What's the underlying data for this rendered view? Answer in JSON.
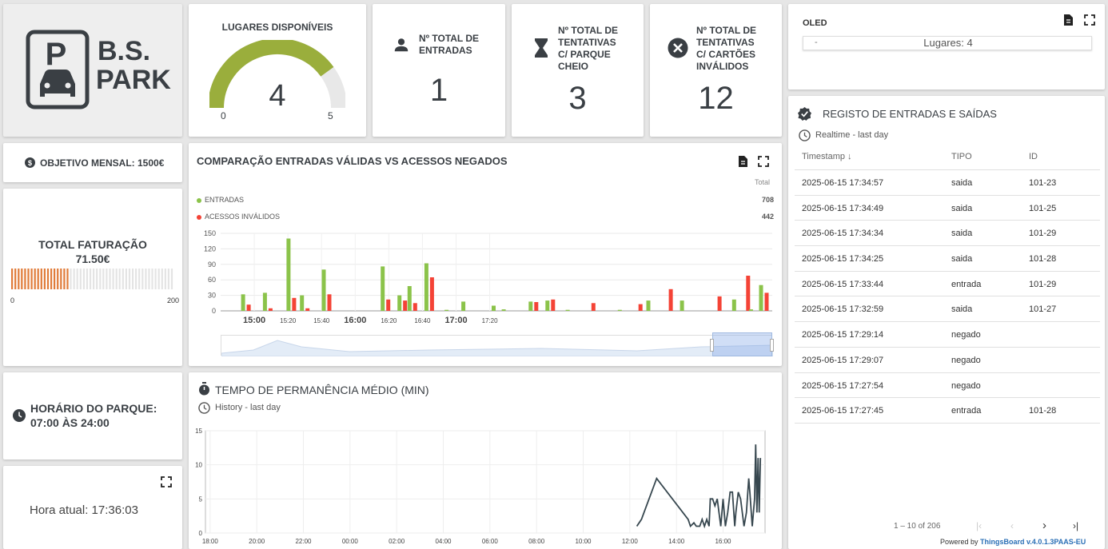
{
  "logo": {
    "title_line1": "B.S.",
    "title_line2": "PARK",
    "sign_letter": "P"
  },
  "lugares": {
    "title": "LUGARES DISPONÍVEIS",
    "value": "4",
    "min": "0",
    "max": "5",
    "fraction": 0.8
  },
  "entradas": {
    "title": "Nº TOTAL DE ENTRADAS",
    "value": "1"
  },
  "tentativas_cheio": {
    "title_lines": [
      "Nº TOTAL DE",
      "TENTATIVAS",
      "C/ PARQUE",
      "CHEIO"
    ],
    "value": "3"
  },
  "tentativas_invalidos": {
    "title_lines": [
      "Nº TOTAL DE",
      "TENTATIVAS",
      "C/ CARTÕES",
      "INVÁLIDOS"
    ],
    "value": "12"
  },
  "oled": {
    "title": "OLED",
    "dash": "-",
    "text": "Lugares: 4"
  },
  "objetivo": {
    "label": "OBJETIVO MENSAL: 1500€"
  },
  "faturacao": {
    "title": "TOTAL FATURAÇÃO",
    "value": "71.50€",
    "min": "0",
    "max": "200",
    "fraction": 0.3575
  },
  "horario": {
    "line1": "HORÁRIO DO PARQUE:",
    "line2": "07:00 ÀS 24:00"
  },
  "hora": {
    "label": "Hora atual: 17:36:03"
  },
  "comparacao": {
    "title": "COMPARAÇÃO ENTRADAS VÁLIDAS VS ACESSOS NEGADOS",
    "total_header": "Total",
    "legend": [
      {
        "name": "ENTRADAS",
        "total": "708",
        "color": "#8bc34a"
      },
      {
        "name": "ACESSOS INVÁLIDOS",
        "total": "442",
        "color": "#f44336"
      }
    ]
  },
  "tempo": {
    "title": "TEMPO DE PERMANÊNCIA MÉDIO (MIN)",
    "subtitle": "History - last day"
  },
  "registo": {
    "title": "REGISTO DE ENTRADAS E SAÍDAS",
    "subtitle": "Realtime - last day",
    "columns": [
      "Timestamp ↓",
      "TIPO",
      "ID"
    ],
    "rows": [
      [
        "2025-06-15 17:34:57",
        "saida",
        "101-23"
      ],
      [
        "2025-06-15 17:34:49",
        "saida",
        "101-25"
      ],
      [
        "2025-06-15 17:34:34",
        "saida",
        "101-29"
      ],
      [
        "2025-06-15 17:34:25",
        "saida",
        "101-28"
      ],
      [
        "2025-06-15 17:33:44",
        "entrada",
        "101-29"
      ],
      [
        "2025-06-15 17:32:59",
        "saida",
        "101-27"
      ],
      [
        "2025-06-15 17:29:14",
        "negado",
        ""
      ],
      [
        "2025-06-15 17:29:07",
        "negado",
        ""
      ],
      [
        "2025-06-15 17:27:54",
        "negado",
        ""
      ],
      [
        "2025-06-15 17:27:45",
        "entrada",
        "101-28"
      ]
    ],
    "pagination": "1 – 10 of 206"
  },
  "footer": {
    "powered": "Powered by",
    "brand": "ThingsBoard v.4.0.1.3PAAS-EU"
  },
  "chart_data": [
    {
      "type": "bar",
      "title": "COMPARAÇÃO ENTRADAS VÁLIDAS VS ACESSOS NEGADOS",
      "ylim": [
        0,
        150
      ],
      "y_ticks": [
        "0",
        "30",
        "60",
        "90",
        "120",
        "150"
      ],
      "x_ticks": [
        "15:00",
        "15:20",
        "15:40",
        "16:00",
        "16:20",
        "16:40",
        "17:00",
        "17:20"
      ],
      "x_tick_major": [
        true,
        false,
        false,
        true,
        false,
        false,
        true,
        false
      ],
      "x_minutes": [
        295,
        308,
        322,
        330,
        343,
        352,
        378,
        388,
        394,
        404,
        416,
        426,
        444,
        450,
        466,
        476,
        488,
        500,
        519,
        528,
        536,
        546,
        548,
        556,
        575,
        587,
        592,
        597,
        603
      ],
      "series": [
        {
          "name": "ENTRADAS",
          "values": [
            32,
            35,
            140,
            30,
            80,
            0,
            86,
            30,
            48,
            92,
            2,
            18,
            10,
            3,
            18,
            20,
            2,
            0,
            2,
            0,
            20,
            0,
            0,
            20,
            0,
            22,
            0,
            3,
            50
          ]
        },
        {
          "name": "ACESSOS INVÁLIDOS",
          "values": [
            12,
            5,
            25,
            5,
            32,
            0,
            22,
            20,
            15,
            65,
            0,
            0,
            0,
            0,
            17,
            22,
            0,
            15,
            0,
            13,
            0,
            42,
            0,
            0,
            28,
            0,
            68,
            0,
            35
          ]
        }
      ],
      "grid": true
    },
    {
      "type": "line",
      "title": "TEMPO DE PERMANÊNCIA MÉDIO (MIN)",
      "ylim": [
        0,
        15
      ],
      "y_ticks": [
        "0",
        "5",
        "10",
        "15"
      ],
      "x_ticks": [
        "18:00",
        "20:00",
        "22:00",
        "00:00",
        "02:00",
        "04:00",
        "06:00",
        "08:00",
        "10:00",
        "12:00",
        "14:00",
        "16:00"
      ],
      "x_hours": [
        12.3,
        12.5,
        13.15,
        14.5,
        14.6,
        14.75,
        14.85,
        15.0,
        15.1,
        15.2,
        15.3,
        15.4,
        15.45,
        15.55,
        15.65,
        15.75,
        15.9,
        16.0,
        16.1,
        16.2,
        16.3,
        16.4,
        16.5,
        16.55,
        16.65,
        16.75,
        16.9,
        17.0,
        17.1,
        17.15,
        17.25,
        17.35,
        17.4,
        17.45,
        17.5,
        17.55,
        17.6
      ],
      "values": [
        1,
        2,
        8,
        2,
        1,
        1.5,
        1,
        1,
        2,
        1,
        2,
        1,
        5,
        5,
        4,
        5,
        1,
        5,
        1,
        3,
        6,
        6,
        1,
        3,
        6,
        5,
        1,
        3,
        8,
        6,
        1,
        5,
        13,
        3,
        11,
        3,
        11
      ]
    }
  ]
}
